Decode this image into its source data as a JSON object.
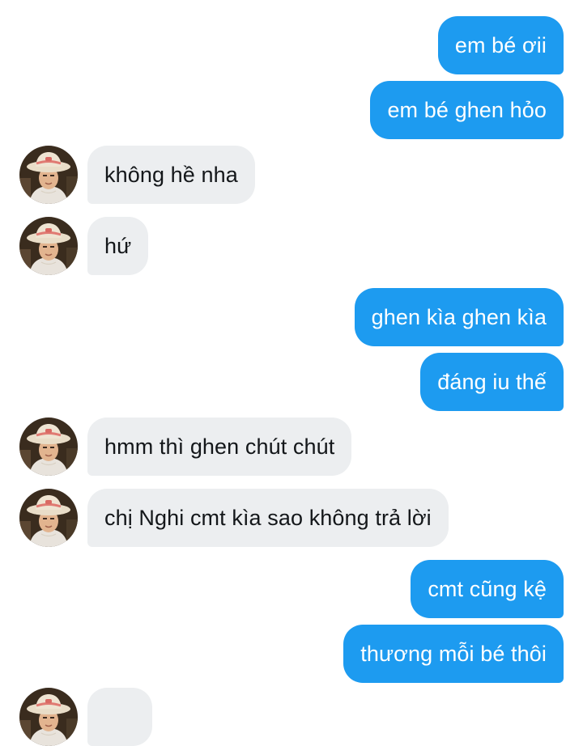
{
  "conversation": {
    "messages": [
      {
        "side": "out",
        "text": "em bé ơii"
      },
      {
        "side": "out",
        "text": "em bé ghen hỏo"
      },
      {
        "side": "in",
        "text": "không hề nha"
      },
      {
        "side": "in",
        "text": "hứ"
      },
      {
        "side": "out",
        "text": "ghen kìa ghen kìa"
      },
      {
        "side": "out",
        "text": "đáng iu thế"
      },
      {
        "side": "in",
        "text": "hmm thì ghen chút chút"
      },
      {
        "side": "in",
        "text": "chị Nghi cmt kìa sao không trả lời"
      },
      {
        "side": "out",
        "text": "cmt cũng kệ"
      },
      {
        "side": "out",
        "text": "thương mỗi bé thôi"
      }
    ]
  },
  "colors": {
    "outgoing_bubble": "#1d9bf0",
    "outgoing_text": "#ffffff",
    "incoming_bubble": "#eceef0",
    "incoming_text": "#14171a"
  },
  "icons": {
    "contact_avatar": "avatar-photo-icon"
  }
}
